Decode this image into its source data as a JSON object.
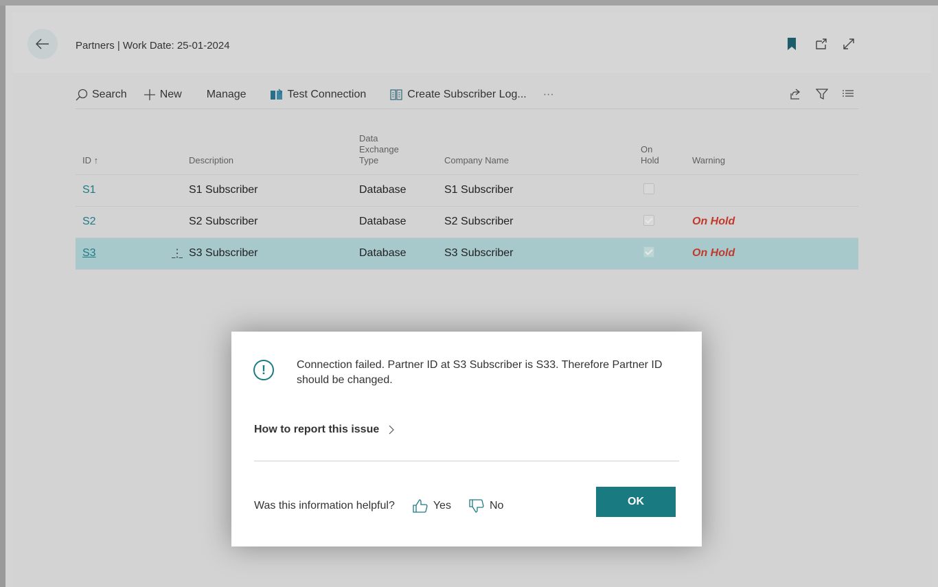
{
  "header": {
    "title": "Partners | Work Date: 25-01-2024"
  },
  "toolbar": {
    "search": "Search",
    "new": "New",
    "manage": "Manage",
    "test_connection": "Test Connection",
    "create_subscriber_log": "Create Subscriber Log...",
    "more": "···"
  },
  "table": {
    "headers": {
      "id": "ID ↑",
      "description": "Description",
      "data_exchange_type": [
        "Data",
        "Exchange",
        "Type"
      ],
      "company_name": "Company Name",
      "on_hold": [
        "On",
        "Hold"
      ],
      "warning": "Warning"
    },
    "rows": [
      {
        "id": "S1",
        "description": "S1 Subscriber",
        "type": "Database",
        "company": "S1 Subscriber",
        "on_hold": false,
        "warning": ""
      },
      {
        "id": "S2",
        "description": "S2 Subscriber",
        "type": "Database",
        "company": "S2 Subscriber",
        "on_hold": true,
        "warning": "On Hold"
      },
      {
        "id": "S3",
        "description": "S3 Subscriber",
        "type": "Database",
        "company": "S3 Subscriber",
        "on_hold": true,
        "warning": "On Hold",
        "selected": true
      }
    ],
    "row_menu": "⋮"
  },
  "dialog": {
    "icon": "!",
    "message": "Connection failed. Partner ID at S3 Subscriber is S33. Therefore Partner ID should be changed.",
    "report_link": "How to report this issue",
    "feedback_question": "Was this information helpful?",
    "yes": "Yes",
    "no": "No",
    "ok": "OK"
  },
  "colors": {
    "accent": "#1a7a82",
    "selected_row": "#a8c9cc",
    "warning": "#c0392b"
  }
}
